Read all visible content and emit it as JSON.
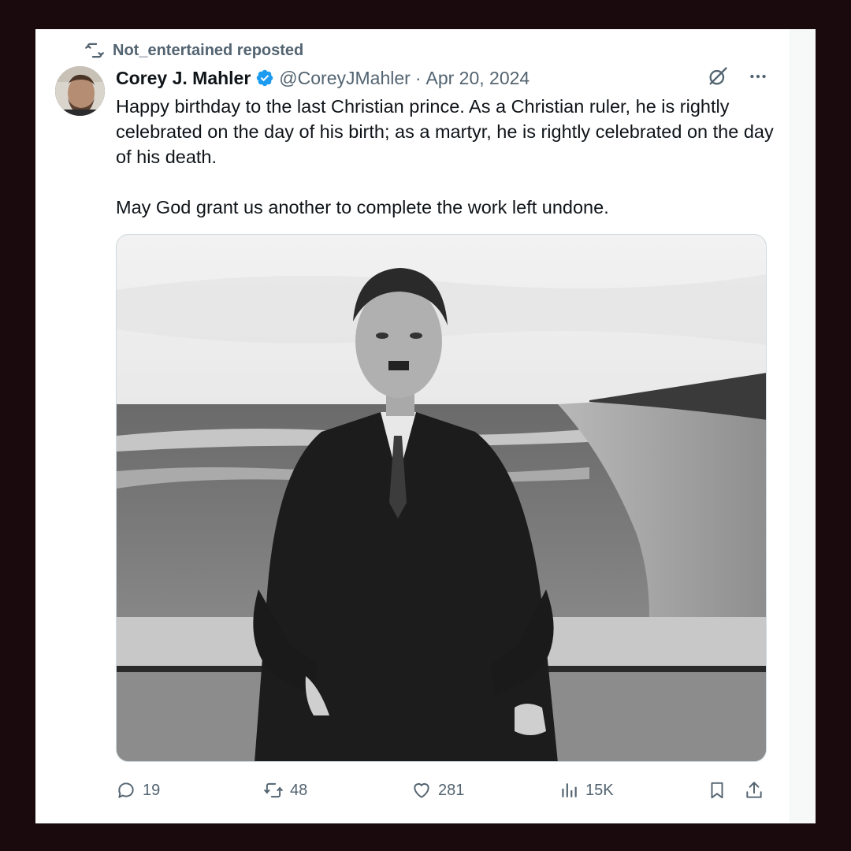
{
  "repost": {
    "text": "Not_entertained reposted",
    "icon": "repost-icon"
  },
  "author": {
    "name": "Corey J. Mahler",
    "handle": "@CoreyJMahler",
    "separator": "·",
    "date": "Apr 20, 2024",
    "verified_color": "#1d9bf0"
  },
  "tweet": {
    "text": "Happy birthday to the last Christian prince. As a Christian ruler, he is rightly celebrated on the day of his birth; as a martyr, he is rightly celebrated on the day of his death.\n\nMay God grant us another to complete the work left undone."
  },
  "stats": {
    "replies": "19",
    "reposts": "48",
    "likes": "281",
    "views": "15K"
  },
  "colors": {
    "background": "#1a0a0e",
    "card": "#ffffff",
    "secondary_text": "#536471",
    "primary_text": "#0f1419",
    "accent": "#1d9bf0"
  }
}
